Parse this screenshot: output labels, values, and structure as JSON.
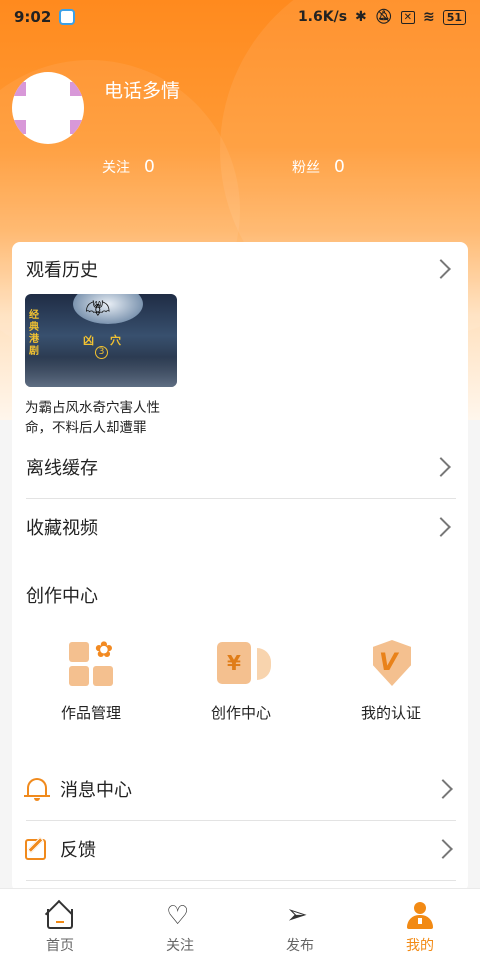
{
  "status_bar": {
    "time": "9:02",
    "network_speed": "1.6K/s",
    "battery": "51"
  },
  "profile": {
    "username": "电话多情",
    "follow_label": "关注",
    "follow_count": "0",
    "fans_label": "粉丝",
    "fans_count": "0"
  },
  "history": {
    "title": "观看历史",
    "video": {
      "title": "为霸占风水奇穴害人性命，不料后人却遭罪",
      "thumb_side_text": "经典港剧",
      "thumb_title": "凶穴",
      "thumb_episode": "3"
    }
  },
  "menu": {
    "offline_cache": "离线缓存",
    "favorites": "收藏视频"
  },
  "creation": {
    "section_title": "创作中心",
    "tools": [
      {
        "label": "作品管理",
        "icon": "works-manage-icon"
      },
      {
        "label": "创作中心",
        "icon": "creation-center-icon"
      },
      {
        "label": "我的认证",
        "icon": "verification-shield-icon"
      }
    ]
  },
  "list": {
    "messages": "消息中心",
    "feedback": "反馈"
  },
  "tabbar": {
    "tabs": [
      {
        "label": "首页",
        "icon": "home-icon",
        "active": false
      },
      {
        "label": "关注",
        "icon": "heart-planet-icon",
        "active": false
      },
      {
        "label": "发布",
        "icon": "send-plane-icon",
        "active": false
      },
      {
        "label": "我的",
        "icon": "user-icon",
        "active": true
      }
    ]
  },
  "colors": {
    "accent": "#f28a14",
    "header_gradient_top": "#ff8a1e"
  }
}
